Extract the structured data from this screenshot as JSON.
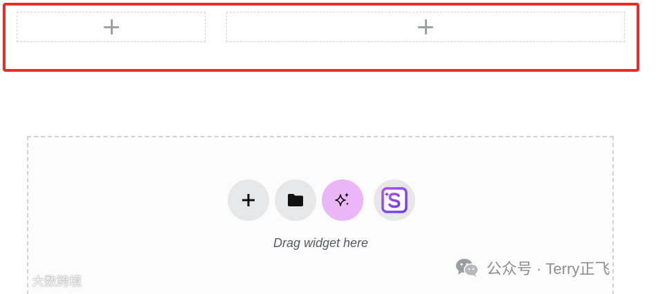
{
  "drop_zone": {
    "hint": "Drag widget here"
  },
  "action_buttons": [
    {
      "icon": "plus-icon"
    },
    {
      "icon": "folder-icon"
    },
    {
      "icon": "sparkles-icon"
    },
    {
      "icon": "s-logo-icon"
    }
  ],
  "watermarks": {
    "left": "大数跨境",
    "right": "公众号 · Terry正飞"
  },
  "colors": {
    "highlight_border": "#ee2a24",
    "ai_button_bg": "#eab6f7",
    "brand_purple": "#8a3df0"
  }
}
